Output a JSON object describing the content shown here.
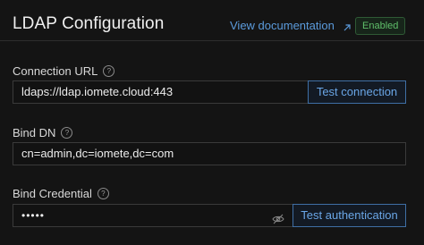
{
  "header": {
    "title": "LDAP Configuration",
    "doc_link_label": "View documentation",
    "status_badge": "Enabled"
  },
  "fields": {
    "connection_url": {
      "label": "Connection URL",
      "help_glyph": "?",
      "value": "ldaps://ldap.iomete.cloud:443",
      "button_label": "Test connection"
    },
    "bind_dn": {
      "label": "Bind DN",
      "help_glyph": "?",
      "value": "cn=admin,dc=iomete,dc=com"
    },
    "bind_credential": {
      "label": "Bind Credential",
      "help_glyph": "?",
      "value": "•••••",
      "button_label": "Test authentication"
    }
  },
  "colors": {
    "background": "#141414",
    "link": "#5b9bdc",
    "badge_green": "#5fbf6a",
    "button_border": "#3f6fa5"
  },
  "icons": {
    "external_link": "external-link-icon",
    "help": "help-circle-icon",
    "password_visibility": "eye-off-icon"
  }
}
